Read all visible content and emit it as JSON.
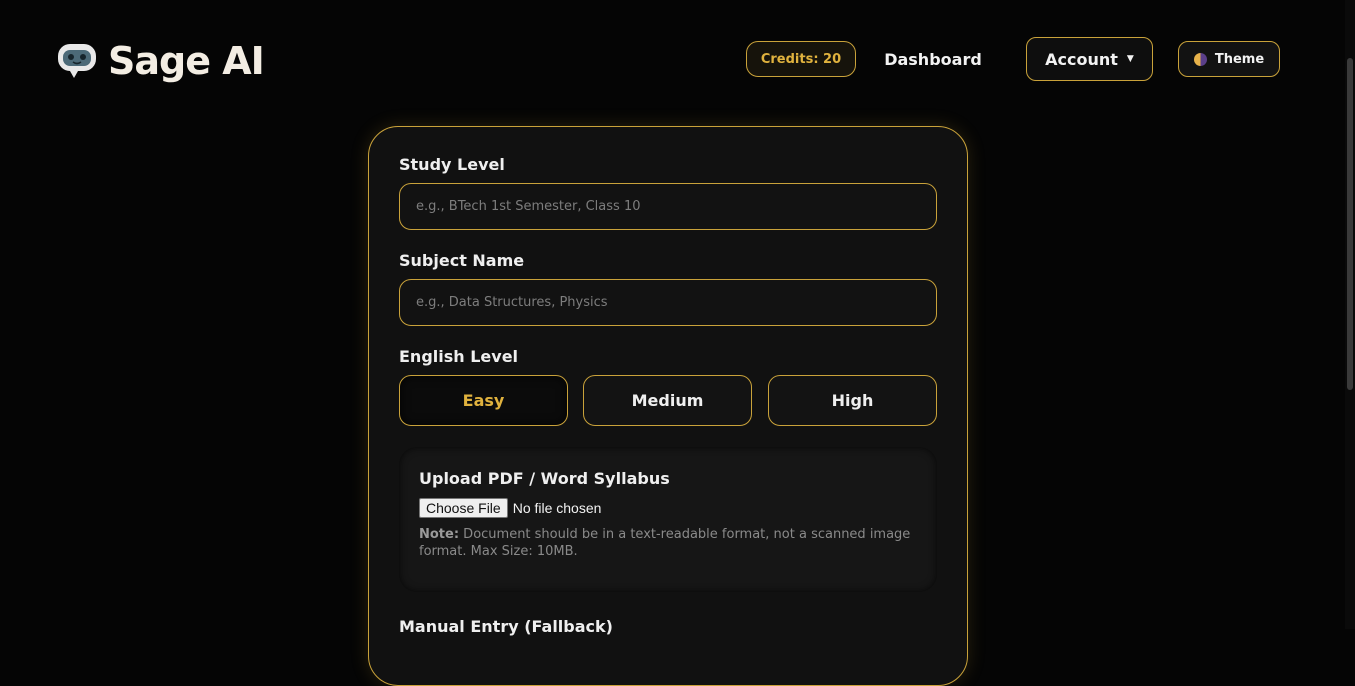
{
  "header": {
    "brand": "Sage AI",
    "credits_label": "Credits: 20",
    "dashboard_label": "Dashboard",
    "account_label": "Account",
    "theme_label": "Theme"
  },
  "form": {
    "study_level": {
      "label": "Study Level",
      "placeholder": "e.g., BTech 1st Semester, Class 10",
      "value": ""
    },
    "subject_name": {
      "label": "Subject Name",
      "placeholder": "e.g., Data Structures, Physics",
      "value": ""
    },
    "english_level": {
      "label": "English Level",
      "options": [
        "Easy",
        "Medium",
        "High"
      ],
      "selected": "Easy"
    },
    "upload": {
      "title": "Upload PDF / Word Syllabus",
      "choose_button": "Choose File",
      "file_status": "No file chosen",
      "note_prefix": "Note:",
      "note_text": " Document should be in a text-readable format, not a scanned image format. Max Size: 10MB."
    },
    "manual_entry_label": "Manual Entry (Fallback)"
  },
  "colors": {
    "accent": "#c9a23a",
    "accent_text": "#e0b23e",
    "background": "#050505",
    "card": "#111111"
  },
  "icons": {
    "logo": "robot-chat-bubble-icon",
    "account_caret": "caret-down-icon",
    "theme": "half-moon-theme-icon"
  }
}
